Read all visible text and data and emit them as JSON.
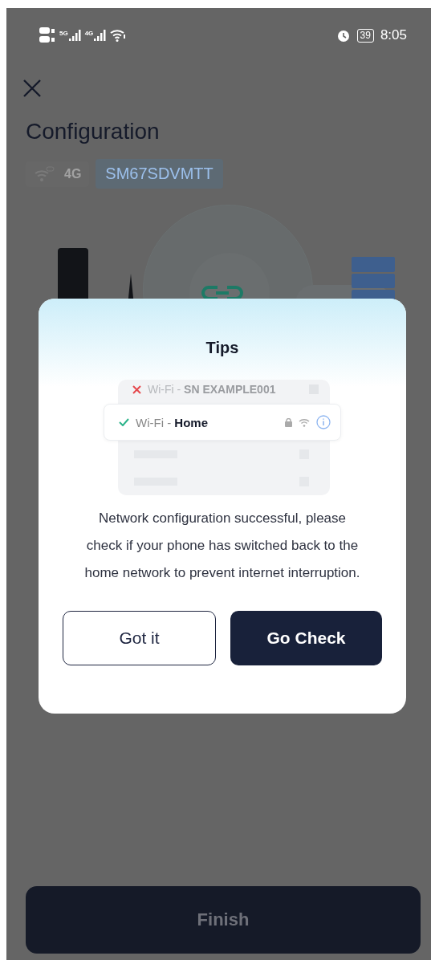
{
  "status_bar": {
    "signals": [
      "5G",
      "4G"
    ],
    "battery": "39",
    "time": "8:05"
  },
  "page": {
    "title": "Configuration",
    "network_badges": [
      {
        "kind": "wifi"
      },
      {
        "kind": "cellular",
        "label": "4G"
      }
    ],
    "device_sn": "SM67SDVMTT"
  },
  "dialog": {
    "title": "Tips",
    "wifi_list": [
      {
        "kind": "failed",
        "label": "Wi-Fi - **SN EXAMPLE001**",
        "selected": false
      },
      {
        "kind": "connected",
        "label": "Wi-Fi - **Home**",
        "selected": true
      }
    ],
    "message": "Network configuration successful, please check if your phone has switched back to the home network to prevent internet interruption.",
    "buttons": [
      {
        "label": "Got it",
        "kind": "secondary"
      },
      {
        "label": "Go Check",
        "kind": "primary"
      }
    ]
  },
  "finish_button": {
    "label": "Finish",
    "disabled": true
  }
}
